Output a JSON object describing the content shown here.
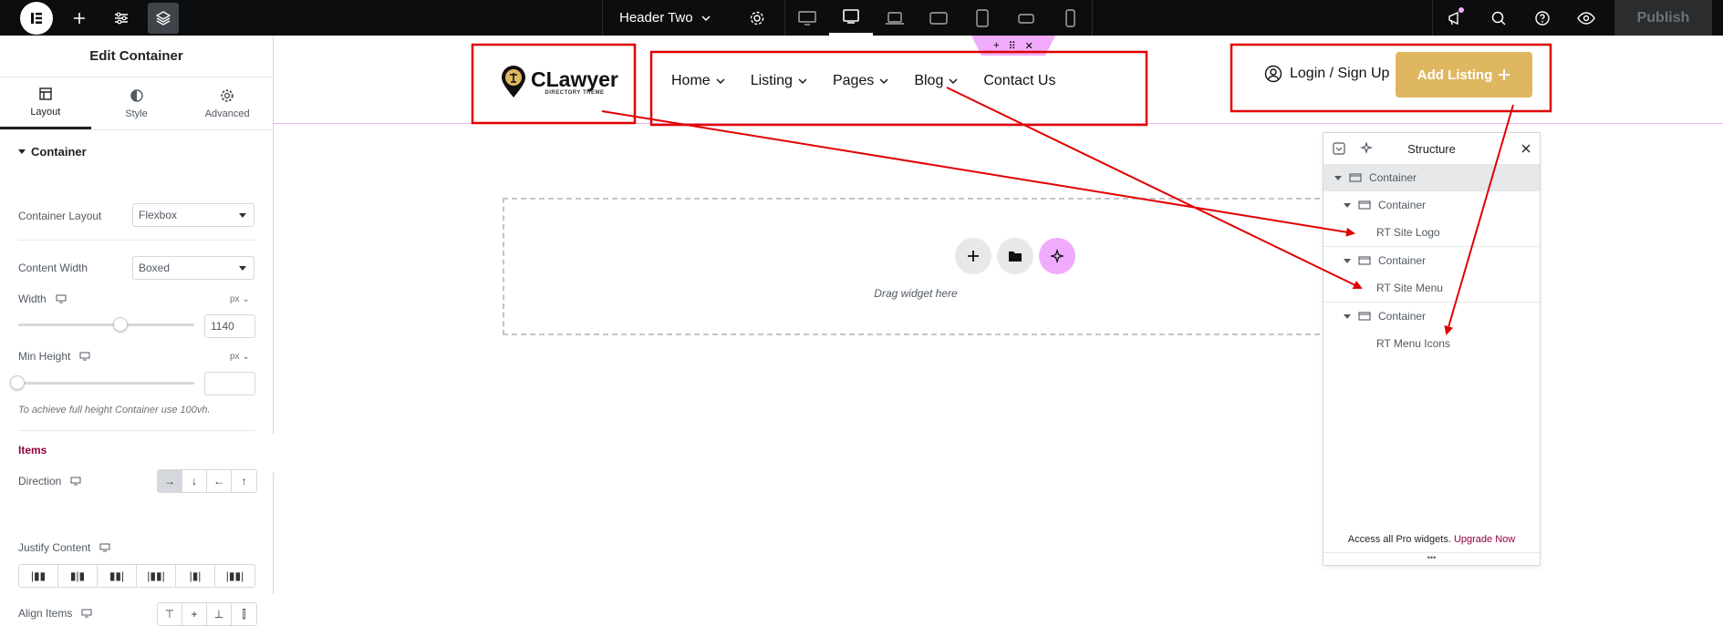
{
  "topbar": {
    "document_title": "Header Two",
    "publish_label": "Publish",
    "devices": [
      "desktop",
      "tablet-landscape",
      "laptop",
      "tablet-wide",
      "tablet-portrait",
      "mobile-landscape",
      "mobile"
    ]
  },
  "panel": {
    "title": "Edit Container",
    "tabs": [
      {
        "label": "Layout",
        "icon": "layout-icon"
      },
      {
        "label": "Style",
        "icon": "contrast-icon"
      },
      {
        "label": "Advanced",
        "icon": "gear-icon"
      }
    ],
    "section_title": "Container",
    "container_layout": {
      "label": "Container Layout",
      "value": "Flexbox"
    },
    "content_width": {
      "label": "Content Width",
      "value": "Boxed"
    },
    "width": {
      "label": "Width",
      "unit": "px",
      "value": "1140"
    },
    "min_height": {
      "label": "Min Height",
      "unit": "px",
      "value": ""
    },
    "hint": "To achieve full height Container use 100vh.",
    "items_title": "Items",
    "direction": {
      "label": "Direction"
    },
    "justify_content": {
      "label": "Justify Content"
    },
    "align_items": {
      "label": "Align Items"
    }
  },
  "site_header": {
    "logo_text": "CLawyer",
    "logo_sub": "DIRECTORY THEME",
    "nav": [
      "Home",
      "Listing",
      "Pages",
      "Blog",
      "Contact Us"
    ],
    "login_label": "Login / Sign Up",
    "add_listing_label": "Add Listing"
  },
  "dropzone": {
    "text": "Drag widget here"
  },
  "structure": {
    "title": "Structure",
    "rows": [
      {
        "label": "Container",
        "level": 0,
        "type": "container"
      },
      {
        "label": "Container",
        "level": 1,
        "type": "container"
      },
      {
        "label": "RT Site Logo",
        "level": 2,
        "type": "widget"
      },
      {
        "label": "Container",
        "level": 1,
        "type": "container"
      },
      {
        "label": "RT Site Menu",
        "level": 2,
        "type": "widget"
      },
      {
        "label": "Container",
        "level": 1,
        "type": "container"
      },
      {
        "label": "RT Menu Icons",
        "level": 2,
        "type": "widget"
      }
    ],
    "footer_text": "Access all Pro widgets.",
    "footer_link": "Upgrade Now"
  },
  "colors": {
    "annotation_red": "#e00000",
    "accent_gold": "#dfb761",
    "accent_pink": "#f0abfc",
    "link_maroon": "#93003f"
  }
}
